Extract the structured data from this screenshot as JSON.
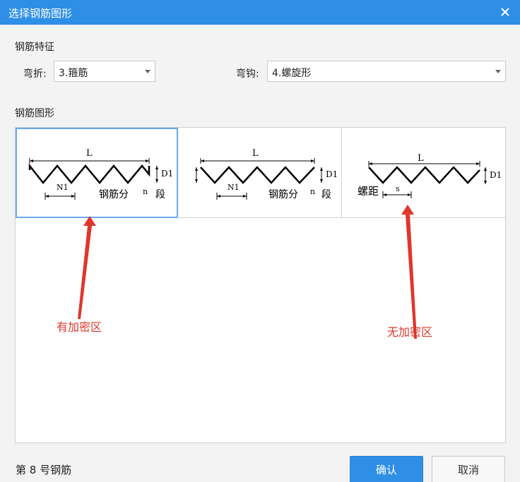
{
  "dialog": {
    "title": "选择钢筋图形",
    "close_icon": "close-icon"
  },
  "features": {
    "section_label": "钢筋特征",
    "bend_label": "弯折:",
    "bend_value": "3.箍筋",
    "hook_label": "弯钩:",
    "hook_value": "4.螺旋形"
  },
  "shapes": {
    "section_label": "钢筋图形",
    "options": [
      {
        "L": "L",
        "D1": "D1",
        "N1": "N1",
        "text": "钢筋分",
        "n": "n",
        "seg": "段"
      },
      {
        "L": "L",
        "D1": "D1",
        "N1": "N1",
        "text": "钢筋分",
        "n": "n",
        "seg": "段"
      },
      {
        "L": "L",
        "D1": "D1",
        "pitch": "螺距",
        "s": "s"
      }
    ]
  },
  "annotations": {
    "left": "有加密区",
    "right": "无加密区",
    "color": "#e0362c"
  },
  "footer": {
    "rebar_label": "第 8 号钢筋",
    "ok_label": "确认",
    "cancel_label": "取消"
  }
}
